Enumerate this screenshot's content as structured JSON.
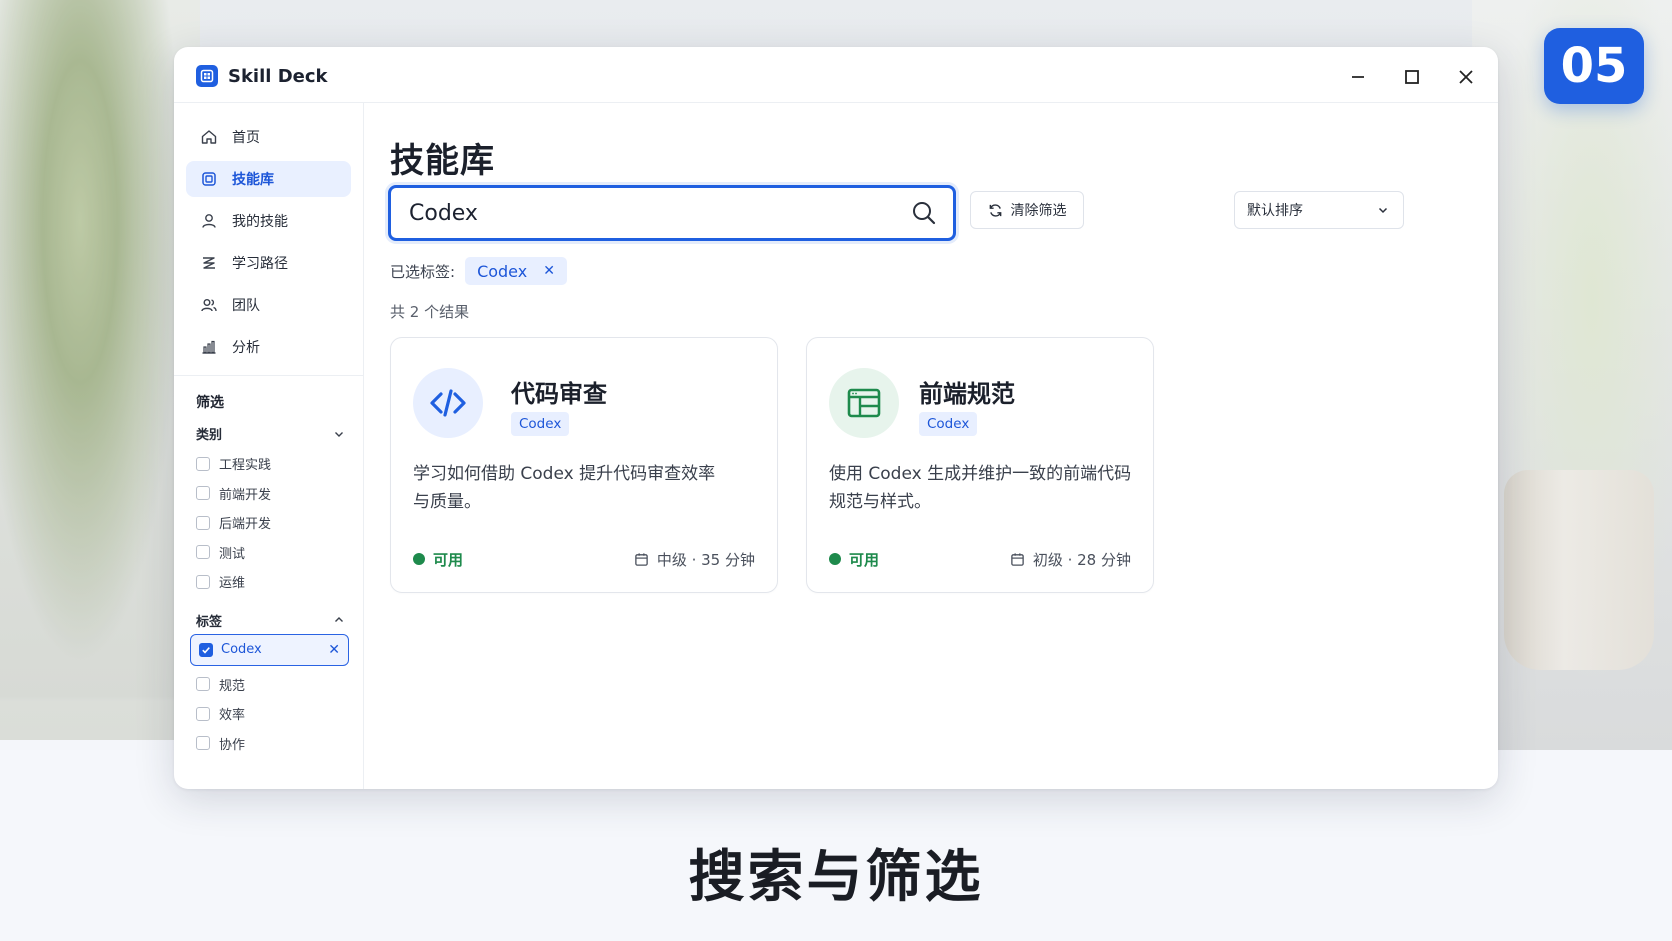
{
  "app": {
    "name": "Skill Deck"
  },
  "sidebar": {
    "nav": [
      {
        "label": "首页",
        "icon": "home-icon"
      },
      {
        "label": "技能库",
        "icon": "library-icon",
        "active": true
      },
      {
        "label": "我的技能",
        "icon": "user-icon"
      },
      {
        "label": "学习路径",
        "icon": "path-icon"
      },
      {
        "label": "团队",
        "icon": "team-icon"
      },
      {
        "label": "分析",
        "icon": "chart-icon"
      }
    ],
    "filter_title": "筛选",
    "category": {
      "label": "类别",
      "options": [
        "工程实践",
        "前端开发",
        "后端开发",
        "测试",
        "运维"
      ]
    },
    "tags": {
      "label": "标签",
      "selected": "Codex",
      "options": [
        "规范",
        "效率",
        "协作"
      ]
    }
  },
  "main": {
    "title": "技能库",
    "search": {
      "value": "Codex"
    },
    "clear_label": "清除筛选",
    "sort_label": "默认排序",
    "selected_tags_label": "已选标签:",
    "selected_tag": "Codex",
    "result_count": "共 2 个结果",
    "cards": [
      {
        "title": "代码审查",
        "tag": "Codex",
        "desc_line1": "学习如何借助 Codex 提升代码审查效率",
        "desc_line2": "与质量。",
        "status": "可用",
        "meta": "中级 · 35 分钟",
        "icon": "code-icon"
      },
      {
        "title": "前端规范",
        "tag": "Codex",
        "desc_line1": "使用 Codex 生成并维护一致的前端代码",
        "desc_line2": "规范与样式。",
        "status": "可用",
        "meta": "初级 · 28 分钟",
        "icon": "layout-icon"
      }
    ]
  },
  "badge": "05",
  "caption": "搜索与筛选",
  "colors": {
    "accent": "#1f5fe0",
    "success": "#1e8a4c",
    "code_icon_bg": "#e8efff",
    "layout_icon_bg": "#e7f4ec"
  }
}
